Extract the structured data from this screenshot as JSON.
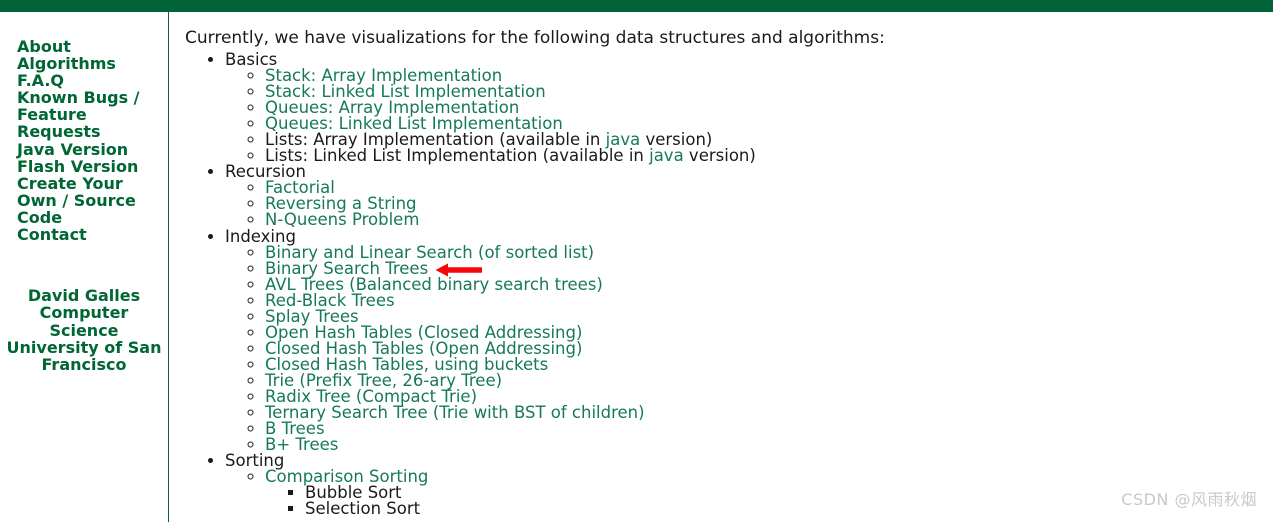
{
  "theme": {
    "topbar_color": "#00633a",
    "sidebar_text_color": "#006633",
    "link_color": "#157a55",
    "body_text_color": "#1a1a1a",
    "arrow_color": "#f40808",
    "watermark_color": "#c9c9c9"
  },
  "sidebar": {
    "items": [
      {
        "label": "About",
        "wrap": false
      },
      {
        "label": "Algorithms",
        "wrap": false
      },
      {
        "label": "F.A.Q",
        "wrap": false
      },
      {
        "label": "Known Bugs / Feature Requests",
        "wrap": true
      },
      {
        "label": "Java Version",
        "wrap": false
      },
      {
        "label": "Flash Version",
        "wrap": false
      },
      {
        "label": "Create Your Own / Source Code",
        "wrap": true
      },
      {
        "label": "Contact",
        "wrap": false
      }
    ],
    "byline": [
      "David Galles",
      "Computer Science",
      "University of San Francisco"
    ]
  },
  "main": {
    "intro": "Currently, we have visualizations for the following data structures and algorithms:",
    "sections": [
      {
        "label": "Basics",
        "items": [
          {
            "kind": "link",
            "text": "Stack: Array Implementation"
          },
          {
            "kind": "link",
            "text": "Stack: Linked List Implementation"
          },
          {
            "kind": "link",
            "text": "Queues: Array Implementation"
          },
          {
            "kind": "link",
            "text": "Queues: Linked List Implementation"
          },
          {
            "kind": "mixed",
            "pre": "Lists: Array Implementation (available in ",
            "link": "java",
            "post": " version)"
          },
          {
            "kind": "mixed",
            "pre": "Lists: Linked List Implementation (available in ",
            "link": "java",
            "post": " version)"
          }
        ]
      },
      {
        "label": "Recursion",
        "items": [
          {
            "kind": "link",
            "text": "Factorial"
          },
          {
            "kind": "link",
            "text": "Reversing a String"
          },
          {
            "kind": "link",
            "text": "N-Queens Problem"
          }
        ]
      },
      {
        "label": "Indexing",
        "items": [
          {
            "kind": "link",
            "text": "Binary and Linear Search (of sorted list)"
          },
          {
            "kind": "link",
            "text": "Binary Search Trees",
            "arrow": true
          },
          {
            "kind": "link",
            "text": "AVL Trees (Balanced binary search trees)"
          },
          {
            "kind": "link",
            "text": "Red-Black Trees"
          },
          {
            "kind": "link",
            "text": "Splay Trees"
          },
          {
            "kind": "link",
            "text": "Open Hash Tables (Closed Addressing)"
          },
          {
            "kind": "link",
            "text": "Closed Hash Tables (Open Addressing)"
          },
          {
            "kind": "link",
            "text": "Closed Hash Tables, using buckets"
          },
          {
            "kind": "link",
            "text": "Trie (Prefix Tree, 26-ary Tree)"
          },
          {
            "kind": "link",
            "text": "Radix Tree (Compact Trie)"
          },
          {
            "kind": "link",
            "text": "Ternary Search Tree (Trie with BST of children)"
          },
          {
            "kind": "link",
            "text": "B Trees"
          },
          {
            "kind": "link",
            "text": "B+ Trees"
          }
        ]
      },
      {
        "label": "Sorting",
        "items": [
          {
            "kind": "link",
            "text": "Comparison Sorting",
            "children": [
              {
                "kind": "plain",
                "text": "Bubble Sort"
              },
              {
                "kind": "plain",
                "text": "Selection Sort"
              }
            ]
          }
        ]
      }
    ]
  },
  "watermark": {
    "text": "CSDN @风雨秋烟"
  }
}
